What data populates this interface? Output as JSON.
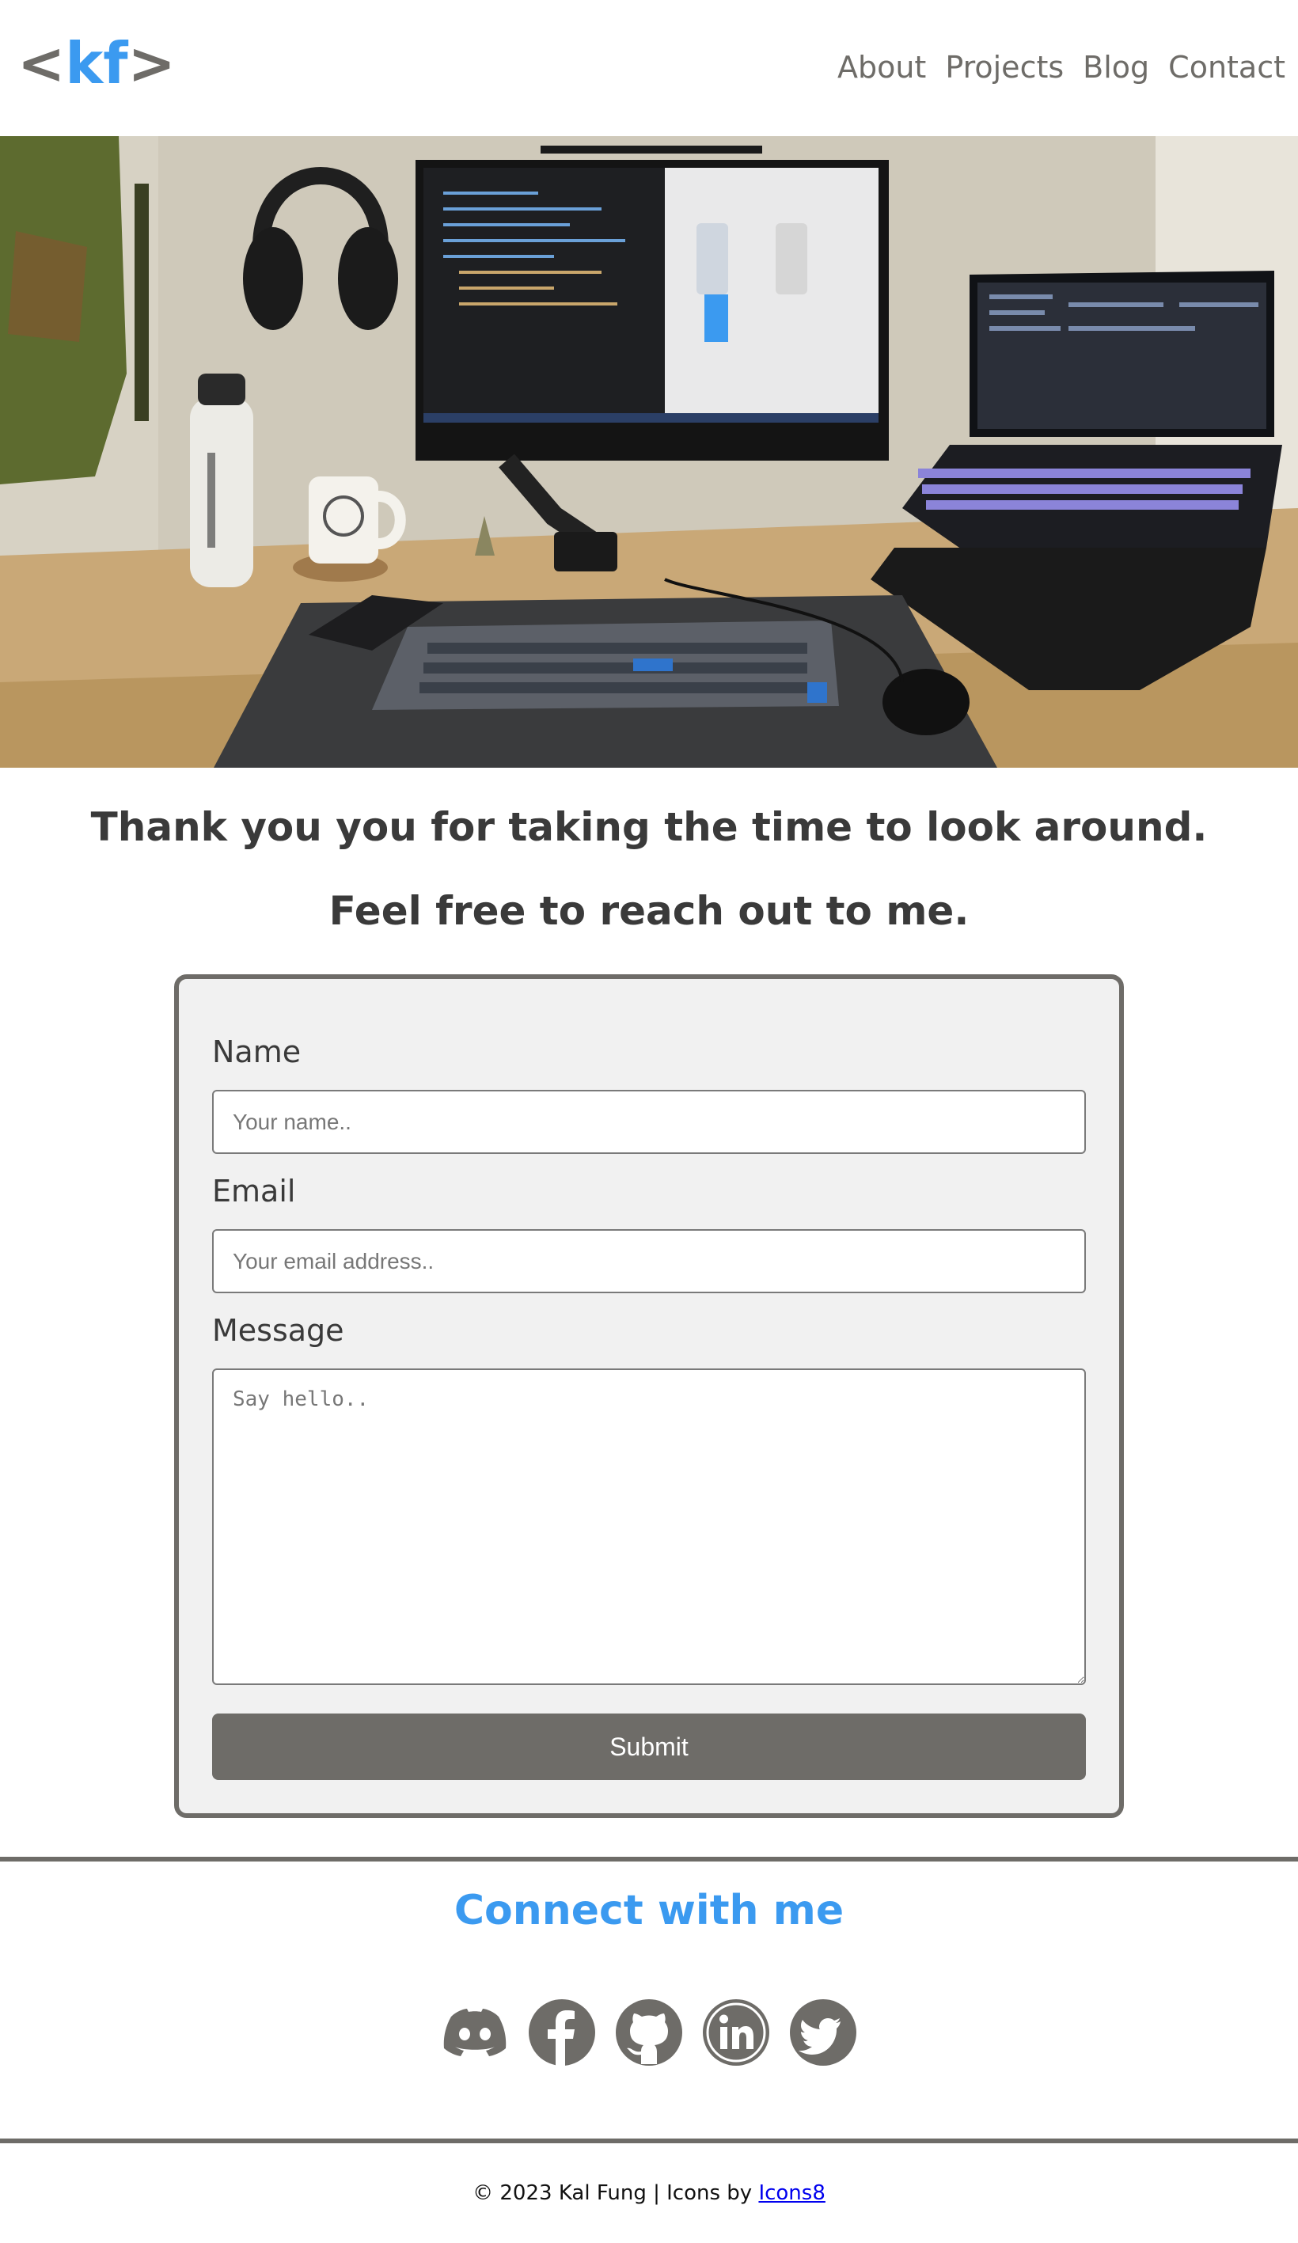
{
  "header": {
    "logo_open": "<",
    "logo_text": "kf",
    "logo_close": ">",
    "nav": [
      {
        "label": "About"
      },
      {
        "label": "Projects"
      },
      {
        "label": "Blog"
      },
      {
        "label": "Contact"
      }
    ]
  },
  "hero": {
    "image_subject": "desk setup with monitor, laptop and keyboard"
  },
  "intro": {
    "line1": "Thank you you for taking the time to look around.",
    "line2": "Feel free to reach out to me."
  },
  "form": {
    "name_label": "Name",
    "name_placeholder": "Your name..",
    "email_label": "Email",
    "email_placeholder": "Your email address..",
    "message_label": "Message",
    "message_placeholder": "Say hello..",
    "submit_label": "Submit"
  },
  "connect": {
    "title": "Connect with me",
    "icons": [
      "discord-icon",
      "facebook-icon",
      "github-icon",
      "linkedin-icon",
      "twitter-icon"
    ]
  },
  "footer": {
    "copyright": "© 2023 Kal Fung | Icons by ",
    "credit_link": "Icons8"
  },
  "colors": {
    "accent": "#3b9af0",
    "gray": "#6e6c68",
    "form_bg": "#f1f1f1"
  }
}
